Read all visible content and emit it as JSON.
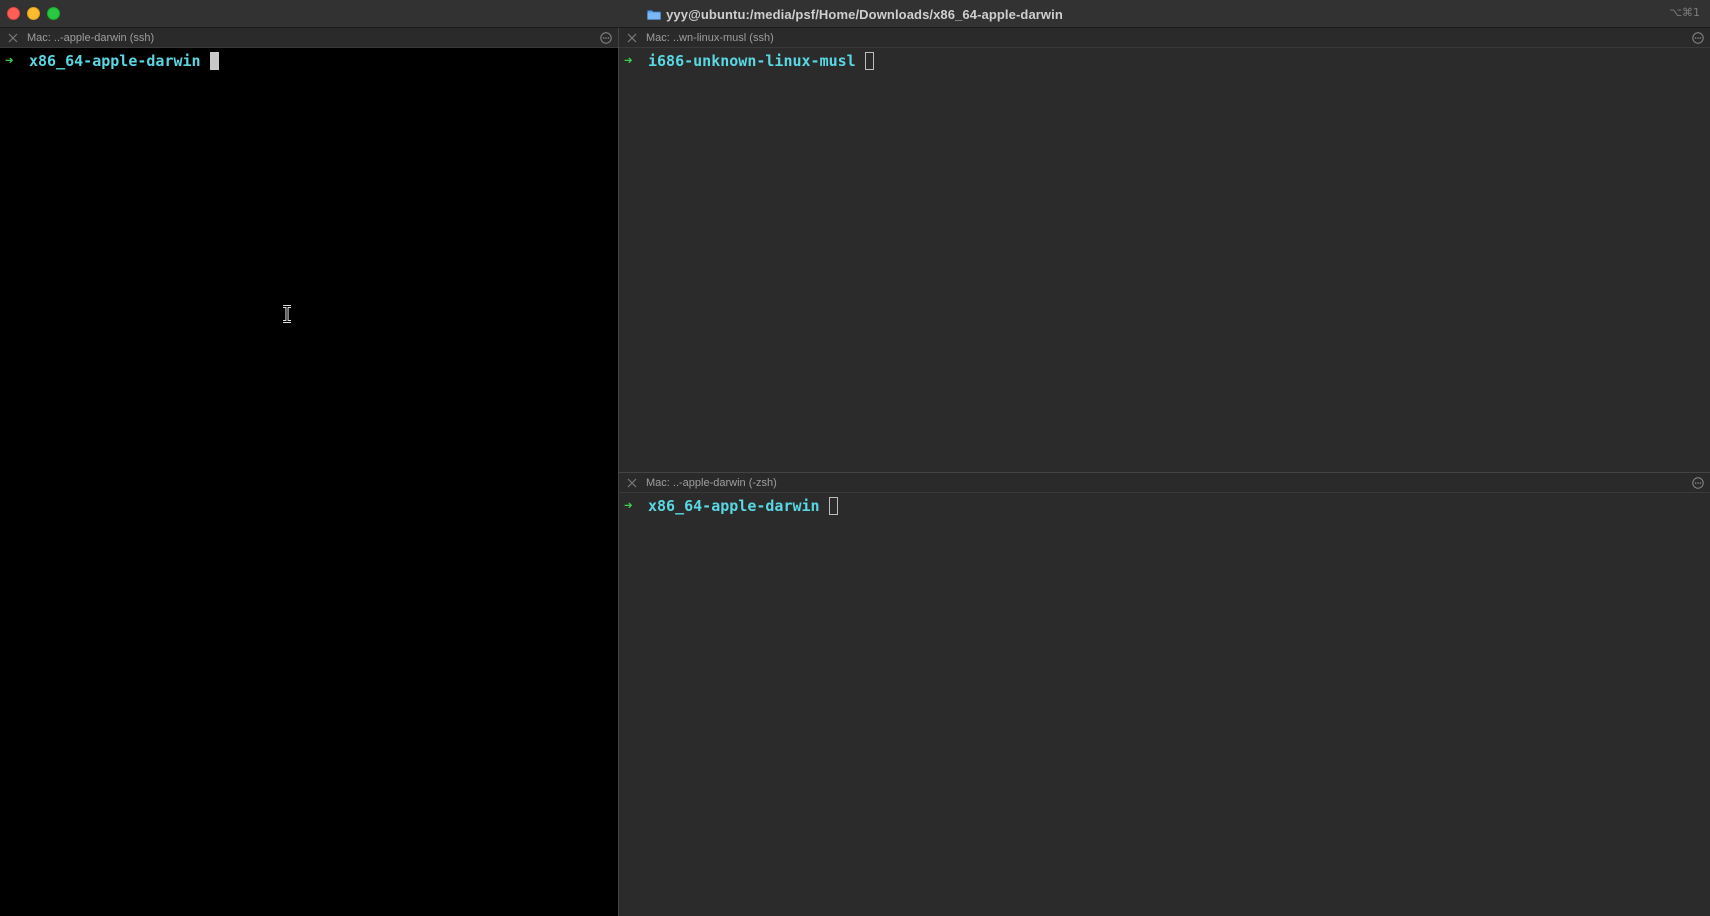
{
  "window": {
    "title": "yyy@ubuntu:/media/psf/Home/Downloads/x86_64-apple-darwin",
    "shortcut": "⌥⌘1",
    "title_icon": "folder-icon"
  },
  "panes": [
    {
      "tab_title": "Mac: ..-apple-darwin (ssh)",
      "prompt_symbol": "➜",
      "cwd": "x86_64-apple-darwin",
      "cursor": "solid",
      "background": "#000000"
    },
    {
      "tab_title": "Mac: ..wn-linux-musl (ssh)",
      "prompt_symbol": "➜",
      "cwd": "i686-unknown-linux-musl",
      "cursor": "hollow",
      "background": "#2b2b2b"
    },
    {
      "tab_title": "Mac: ..-apple-darwin (-zsh)",
      "prompt_symbol": "➜",
      "cwd": "x86_64-apple-darwin",
      "cursor": "hollow",
      "background": "#2b2b2b"
    }
  ],
  "colors": {
    "prompt_arrow": "#3fcf4d",
    "cwd_text": "#59d8e3",
    "close_button": "#ff5f57",
    "minimize_button": "#febc2e",
    "maximize_button": "#28c840"
  }
}
